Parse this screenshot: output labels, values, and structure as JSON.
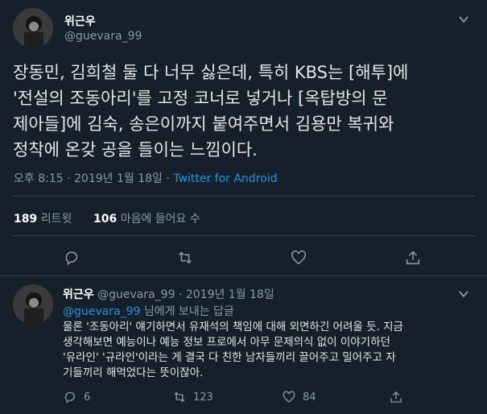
{
  "main_tweet": {
    "display_name": "위근우",
    "handle": "@guevara_99",
    "lines": [
      "장동민, 김희철 둘 다 너무 싫은데, 특히 KBS는 [해투]에",
      "'전설의 조동아리'를 고정 코너로 넣거나 [옥탑방의 문",
      "제아들]에 김숙, 송은이까지 붙여주면서 김용만 복귀와",
      "정착에 온갖 공을 들이는 느낌이다."
    ],
    "time": "오후 8:15",
    "dot": "·",
    "date": "2019년 1월 18일",
    "source": "Twitter for Android",
    "retweet_count": "189",
    "retweet_label": "리트윗",
    "like_count": "106",
    "like_label": "마음에 들어요 수"
  },
  "reply": {
    "display_name": "위근우",
    "handle": "@guevara_99",
    "dot": "·",
    "date": "2019년 1월 18일",
    "reply_to_handle": "@guevara_99",
    "reply_to_suffix": "님에게 보내는 답글",
    "lines": [
      "물론 '조동아리' 얘기하면서 유재석의 책임에 대해 외면하긴 어려울 듯. 지금",
      "생각해보면 예능이나 예능 정보 프로에서 아무 문제의식 없이 이야기하던",
      "'유라인' '규라인'이라는 게 결국 다 친한 남자들끼리 끌어주고 밀어주고 자",
      "기들끼리 해먹었다는 뜻이잖아."
    ],
    "reply_count": "6",
    "retweet_count": "123",
    "like_count": "84"
  },
  "colors": {
    "background": "#15202b",
    "text": "#d9d9d9",
    "muted": "#8899a6",
    "link": "#1b95e0",
    "divider": "#38444d"
  }
}
